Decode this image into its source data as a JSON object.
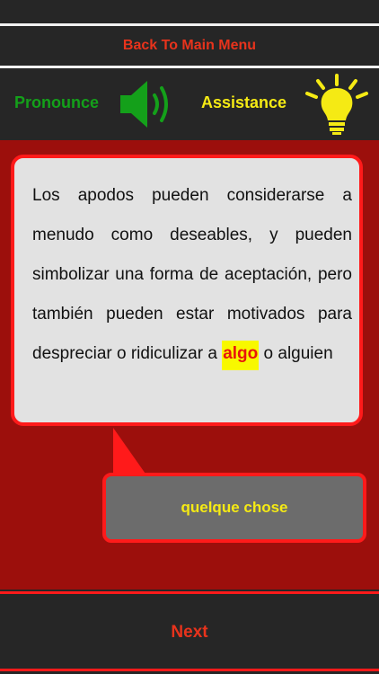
{
  "nav": {
    "back_label": "Back To Main Menu",
    "next_label": "Next"
  },
  "tools": {
    "pronounce_label": "Pronounce",
    "assistance_label": "Assistance",
    "speaker_icon": "speaker-icon",
    "bulb_icon": "lightbulb-icon"
  },
  "sentence": {
    "before": "Los apodos pueden considerarse a menudo como deseables, y pueden simbolizar una forma de aceptación, pero también pueden estar motivados para despreciar o ridiculizar a ",
    "highlighted_word": "algo",
    "after": " o alguien"
  },
  "translation": {
    "text": "quelque chose"
  },
  "colors": {
    "background": "#262626",
    "red_panel": "#9c0f0c",
    "accent_red": "#ff1a1a",
    "pronounce_green": "#14a01a",
    "assistance_yellow": "#f5ea14",
    "highlight_yellow": "#f8f800"
  }
}
